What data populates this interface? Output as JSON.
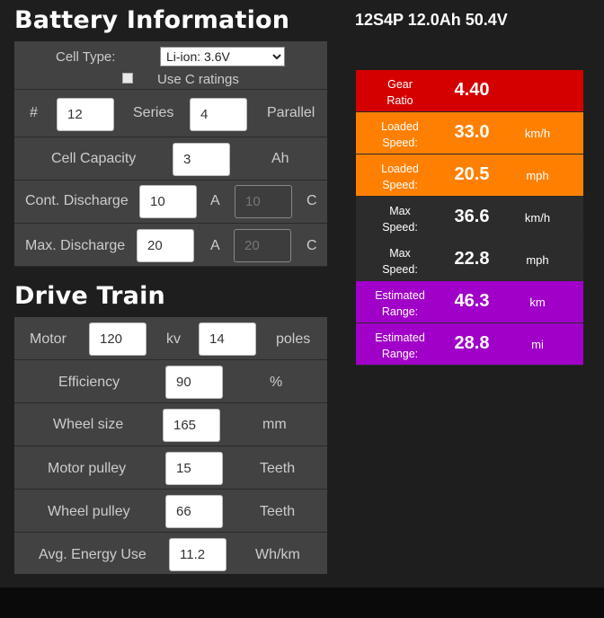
{
  "battery": {
    "title": "Battery Information",
    "cell_type_label": "Cell Type:",
    "cell_type_value": "Li-ion: 3.6V",
    "use_c_ratings_label": "Use C ratings",
    "hash_label": "#",
    "series_value": "12",
    "series_label": "Series",
    "parallel_value": "4",
    "parallel_label": "Parallel",
    "capacity_label": "Cell Capacity",
    "capacity_value": "3",
    "capacity_unit": "Ah",
    "cont_label": "Cont. Discharge",
    "cont_value": "10",
    "cont_unit_a": "A",
    "cont_c_value": "10",
    "cont_unit_c": "C",
    "max_label": "Max. Discharge",
    "max_value": "20",
    "max_unit_a": "A",
    "max_c_value": "20",
    "max_unit_c": "C"
  },
  "drivetrain": {
    "title": "Drive Train",
    "motor_label": "Motor",
    "kv_value": "120",
    "kv_label": "kv",
    "poles_value": "14",
    "poles_label": "poles",
    "efficiency_label": "Efficiency",
    "efficiency_value": "90",
    "efficiency_unit": "%",
    "wheel_size_label": "Wheel size",
    "wheel_size_value": "165",
    "wheel_size_unit": "mm",
    "motor_pulley_label": "Motor pulley",
    "motor_pulley_value": "15",
    "motor_pulley_unit": "Teeth",
    "wheel_pulley_label": "Wheel pulley",
    "wheel_pulley_value": "66",
    "wheel_pulley_unit": "Teeth",
    "energy_label": "Avg. Energy Use",
    "energy_value": "11.2",
    "energy_unit": "Wh/km"
  },
  "config_summary": "12S4P 12.0Ah 50.4V",
  "results": [
    {
      "label_1": "Gear",
      "label_2": "Ratio",
      "value": "4.40",
      "unit": "",
      "color": "#d40000"
    },
    {
      "label_1": "Loaded",
      "label_2": "Speed:",
      "value": "33.0",
      "unit": "km/h",
      "color": "#ff8000"
    },
    {
      "label_1": "Loaded",
      "label_2": "Speed:",
      "value": "20.5",
      "unit": "mph",
      "color": "#ff8000"
    },
    {
      "label_1": "Max",
      "label_2": "Speed:",
      "value": "36.6",
      "unit": "km/h",
      "color": "#2c2c2c"
    },
    {
      "label_1": "Max",
      "label_2": "Speed:",
      "value": "22.8",
      "unit": "mph",
      "color": "#2c2c2c"
    },
    {
      "label_1": "Estimated",
      "label_2": "Range:",
      "value": "46.3",
      "unit": "km",
      "color": "#a000c8"
    },
    {
      "label_1": "Estimated",
      "label_2": "Range:",
      "value": "28.8",
      "unit": "mi",
      "color": "#a000c8"
    }
  ]
}
